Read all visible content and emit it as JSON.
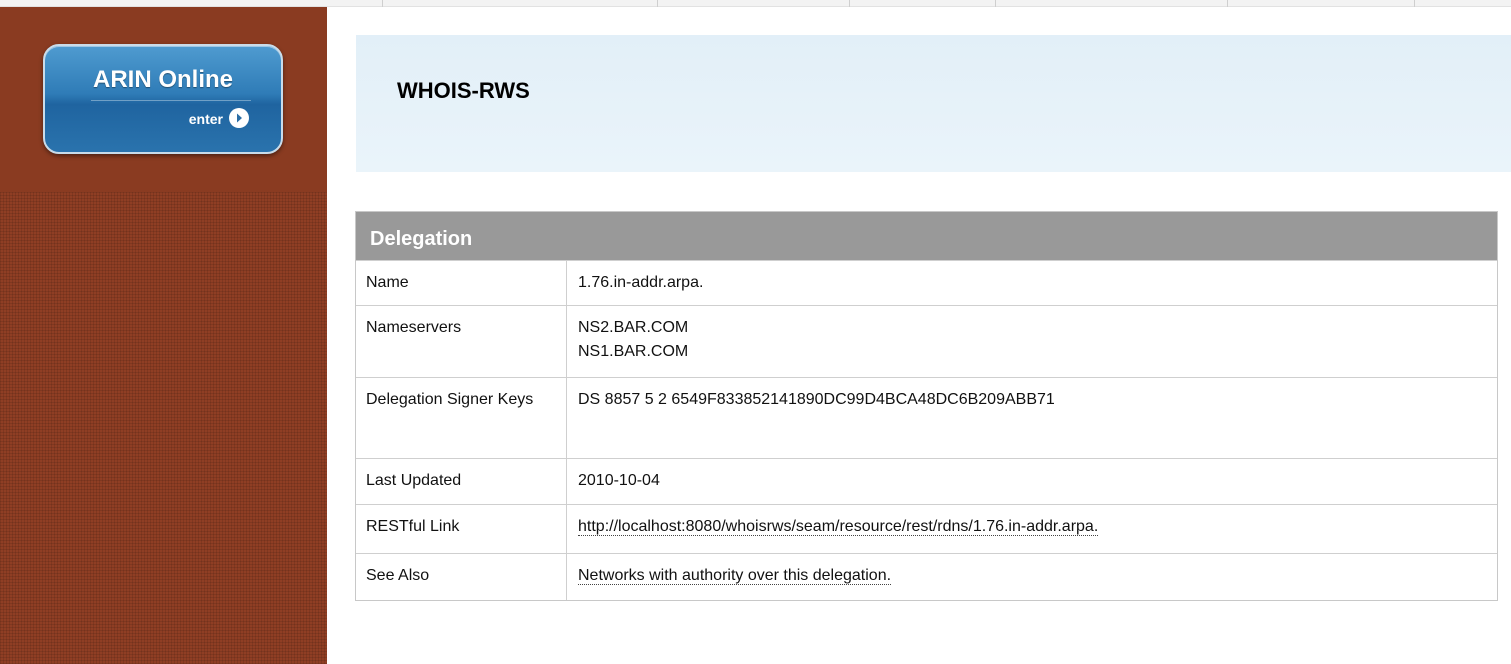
{
  "sidebar": {
    "arin_button": {
      "title": "ARIN Online",
      "enter_label": "enter"
    }
  },
  "header": {
    "title": "WHOIS-RWS"
  },
  "delegation_table": {
    "heading": "Delegation",
    "rows": [
      {
        "label": "Name",
        "values": [
          "1.76.in-addr.arpa."
        ]
      },
      {
        "label": "Nameservers",
        "values": [
          "NS2.BAR.COM",
          "NS1.BAR.COM"
        ]
      },
      {
        "label": "Delegation Signer Keys",
        "values": [
          "DS 8857 5 2 6549F833852141890DC99D4BCA48DC6B209ABB71"
        ]
      },
      {
        "label": "Last Updated",
        "values": [
          "2010-10-04"
        ]
      },
      {
        "label": "RESTful Link",
        "values": [
          "http://localhost:8080/whoisrws/seam/resource/rest/rdns/1.76.in-addr.arpa."
        ]
      },
      {
        "label": "See Also",
        "values": [
          "Networks with authority over this delegation."
        ]
      }
    ]
  },
  "colors": {
    "sidebar_brown": "#8c3c22",
    "button_blue": "#2f7cb7",
    "header_band": "#e2eff8",
    "table_heading": "#999999"
  },
  "icons": {
    "enter_icon": "arrow-circle-right-icon"
  }
}
